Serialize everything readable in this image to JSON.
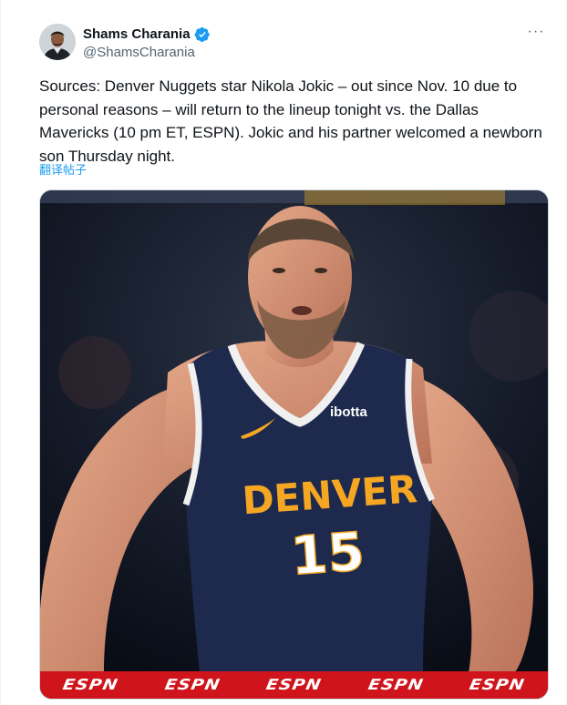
{
  "author": {
    "display_name": "Shams Charania",
    "handle": "@ShamsCharania",
    "verified_icon": "verified-badge-icon",
    "avatar_icon": "avatar"
  },
  "tweet": {
    "text": "Sources: Denver Nuggets star Nikola Jokic – out since Nov. 10 due to personal reasons – will return to the lineup tonight vs. the Dallas Mavericks (10 pm ET, ESPN). Jokic and his partner welcomed a newborn son Thursday night.",
    "translate_label": "翻译帖子",
    "more_label": "···"
  },
  "media": {
    "jersey_sponsor": "ibotta",
    "jersey_team": "DENVER",
    "jersey_number": "15",
    "broadcast_logos": [
      "ESPN",
      "ESPN",
      "ESPN",
      "ESPN",
      "ESPN"
    ],
    "colors": {
      "jersey_navy": "#1d2a4e",
      "jersey_gold": "#f5a623",
      "espn_red": "#d0141c",
      "link_blue": "#1d9bf0",
      "verified_blue": "#1d9bf0"
    }
  }
}
